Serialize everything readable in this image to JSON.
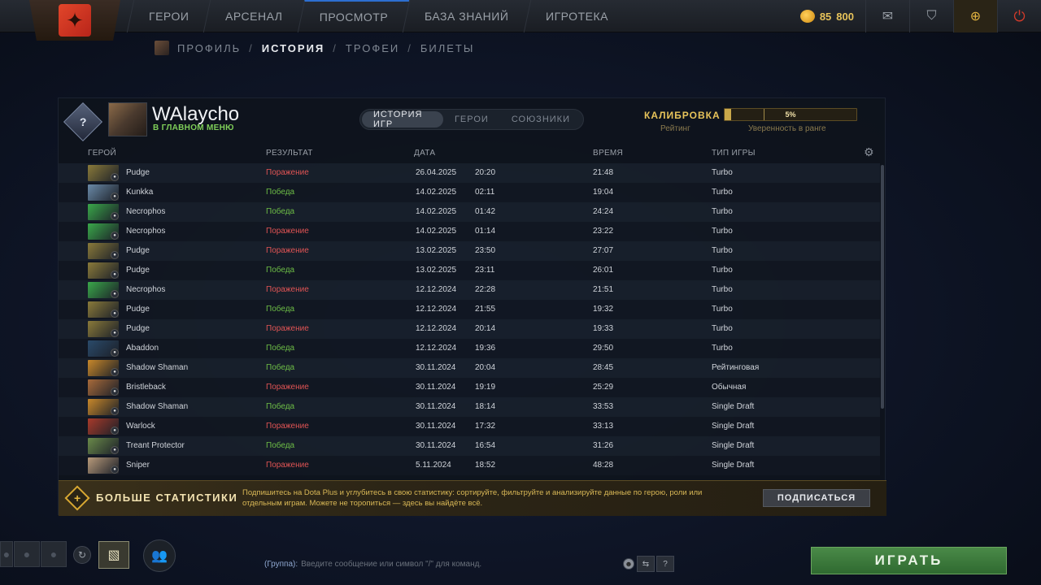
{
  "nav": {
    "items": [
      "ГЕРОИ",
      "АРСЕНАЛ",
      "ПРОСМОТР",
      "БАЗА ЗНАНИЙ",
      "ИГРОТЕКА"
    ],
    "coins_a": "85",
    "coins_b": "800"
  },
  "subnav": {
    "items": [
      "ПРОФИЛЬ",
      "ИСТОРИЯ",
      "ТРОФЕИ",
      "БИЛЕТЫ"
    ],
    "sep": "/"
  },
  "profile": {
    "name": "WAlaycho",
    "status": "В ГЛАВНОМ МЕНЮ",
    "rank_glyph": "?"
  },
  "tabs": [
    "ИСТОРИЯ ИГР",
    "ГЕРОИ",
    "СОЮЗНИКИ"
  ],
  "calibration": {
    "label": "КАЛИБРОВКА",
    "rating_label": "Рейтинг",
    "percent": "5%",
    "progress": 0.05,
    "confidence_label": "Уверенность в ранге"
  },
  "table": {
    "headers": [
      "ГЕРОЙ",
      "РЕЗУЛЬТАТ",
      "ДАТА",
      "ВРЕМЯ",
      "ТИП ИГРЫ"
    ],
    "rows": [
      {
        "hero": "Pudge",
        "result": "Поражение",
        "win": false,
        "date": "26.04.2025",
        "time": "20:20",
        "duration": "21:48",
        "mode": "Turbo",
        "color": "#8a7a3a"
      },
      {
        "hero": "Kunkka",
        "result": "Победа",
        "win": true,
        "date": "14.02.2025",
        "time": "02:11",
        "duration": "19:04",
        "mode": "Turbo",
        "color": "#6a8aa8"
      },
      {
        "hero": "Necrophos",
        "result": "Победа",
        "win": true,
        "date": "14.02.2025",
        "time": "01:42",
        "duration": "24:24",
        "mode": "Turbo",
        "color": "#3aa84a"
      },
      {
        "hero": "Necrophos",
        "result": "Поражение",
        "win": false,
        "date": "14.02.2025",
        "time": "01:14",
        "duration": "23:22",
        "mode": "Turbo",
        "color": "#3aa84a"
      },
      {
        "hero": "Pudge",
        "result": "Поражение",
        "win": false,
        "date": "13.02.2025",
        "time": "23:50",
        "duration": "27:07",
        "mode": "Turbo",
        "color": "#8a7a3a"
      },
      {
        "hero": "Pudge",
        "result": "Победа",
        "win": true,
        "date": "13.02.2025",
        "time": "23:11",
        "duration": "26:01",
        "mode": "Turbo",
        "color": "#8a7a3a"
      },
      {
        "hero": "Necrophos",
        "result": "Поражение",
        "win": false,
        "date": "12.12.2024",
        "time": "22:28",
        "duration": "21:51",
        "mode": "Turbo",
        "color": "#3aa84a"
      },
      {
        "hero": "Pudge",
        "result": "Победа",
        "win": true,
        "date": "12.12.2024",
        "time": "21:55",
        "duration": "19:32",
        "mode": "Turbo",
        "color": "#8a7a3a"
      },
      {
        "hero": "Pudge",
        "result": "Поражение",
        "win": false,
        "date": "12.12.2024",
        "time": "20:14",
        "duration": "19:33",
        "mode": "Turbo",
        "color": "#8a7a3a"
      },
      {
        "hero": "Abaddon",
        "result": "Победа",
        "win": true,
        "date": "12.12.2024",
        "time": "19:36",
        "duration": "29:50",
        "mode": "Turbo",
        "color": "#2a4a6a"
      },
      {
        "hero": "Shadow Shaman",
        "result": "Победа",
        "win": true,
        "date": "30.11.2024",
        "time": "20:04",
        "duration": "28:45",
        "mode": "Рейтинговая",
        "color": "#c8882a"
      },
      {
        "hero": "Bristleback",
        "result": "Поражение",
        "win": false,
        "date": "30.11.2024",
        "time": "19:19",
        "duration": "25:29",
        "mode": "Обычная",
        "color": "#a86a3a"
      },
      {
        "hero": "Shadow Shaman",
        "result": "Победа",
        "win": true,
        "date": "30.11.2024",
        "time": "18:14",
        "duration": "33:53",
        "mode": "Single Draft",
        "color": "#c8882a"
      },
      {
        "hero": "Warlock",
        "result": "Поражение",
        "win": false,
        "date": "30.11.2024",
        "time": "17:32",
        "duration": "33:13",
        "mode": "Single Draft",
        "color": "#a83a2a"
      },
      {
        "hero": "Treant Protector",
        "result": "Победа",
        "win": true,
        "date": "30.11.2024",
        "time": "16:54",
        "duration": "31:26",
        "mode": "Single Draft",
        "color": "#6a8a4a"
      },
      {
        "hero": "Sniper",
        "result": "Поражение",
        "win": false,
        "date": "5.11.2024",
        "time": "18:52",
        "duration": "48:28",
        "mode": "Single Draft",
        "color": "#b89a7a"
      }
    ]
  },
  "banner": {
    "title": "БОЛЬШЕ СТАТИСТИКИ",
    "description": "Подпишитесь на Dota Plus и углубитесь в свою статистику: сортируйте, фильтруйте и анализируйте данные по герою, роли или отдельным играм. Можете не торопиться — здесь вы найдёте всё.",
    "button": "ПОДПИСАТЬСЯ"
  },
  "chat": {
    "channel": "(Группа):",
    "placeholder": "Введите сообщение или символ \"/\" для команд.",
    "help": "?"
  },
  "play": {
    "label": "ИГРАТЬ"
  }
}
